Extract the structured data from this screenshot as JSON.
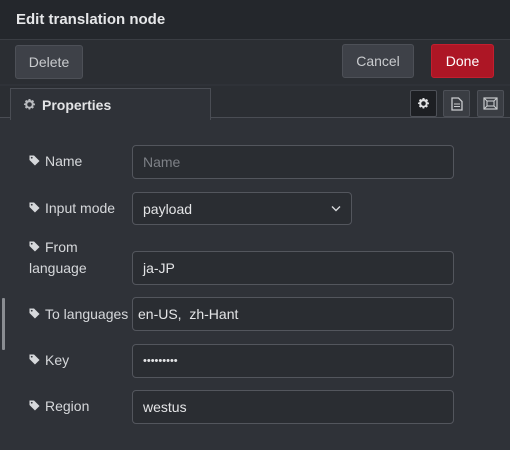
{
  "header": {
    "title": "Edit translation node"
  },
  "toolbar": {
    "delete_label": "Delete",
    "cancel_label": "Cancel",
    "done_label": "Done"
  },
  "tabs": {
    "properties_label": "Properties"
  },
  "icons": {
    "properties_tab": "gear-icon",
    "settings_button": "gear-icon",
    "description_button": "document-icon",
    "appearance_button": "frame-icon",
    "label": "tag-icon",
    "select": "chevron-down-icon"
  },
  "form": {
    "name": {
      "label": "Name",
      "value": "",
      "placeholder": "Name"
    },
    "input_mode": {
      "label": "Input mode",
      "value": "payload"
    },
    "from_language": {
      "label_line1": "From",
      "label_line2": "language",
      "value": "ja-JP"
    },
    "to_languages": {
      "label": "To languages",
      "value": "en-US,  zh-Hant"
    },
    "key": {
      "label": "Key",
      "value": "•••••••••"
    },
    "region": {
      "label": "Region",
      "value": "westus"
    }
  },
  "colors": {
    "done_button": "#ad1625",
    "background": "#2f3238",
    "header": "#24272c"
  }
}
